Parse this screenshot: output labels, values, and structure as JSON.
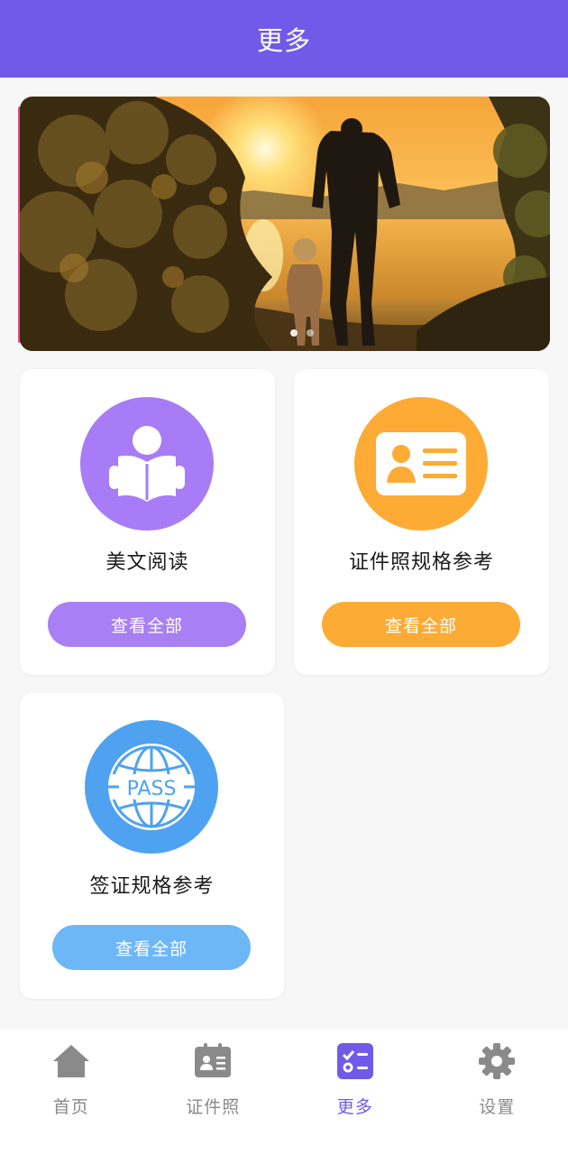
{
  "header": {
    "title": "更多"
  },
  "banner": {
    "active_index": 0,
    "dot_count": 2
  },
  "cards": [
    {
      "title": "美文阅读",
      "button": "查看全部",
      "icon": "reading-book-icon",
      "color": "#a77cf6",
      "button_color": "#a97ff5"
    },
    {
      "title": "证件照规格参考",
      "button": "查看全部",
      "icon": "id-card-icon",
      "color": "#fdab35",
      "button_color": "#fdab35"
    },
    {
      "title": "签证规格参考",
      "button": "查看全部",
      "icon": "passport-globe-icon",
      "icon_text": "PASS",
      "color": "#4ea2f0",
      "button_color": "#6db7f7"
    }
  ],
  "tabbar": {
    "items": [
      {
        "label": "首页",
        "icon": "home-icon",
        "active": false
      },
      {
        "label": "证件照",
        "icon": "id-photo-icon",
        "active": false
      },
      {
        "label": "更多",
        "icon": "more-list-icon",
        "active": true
      },
      {
        "label": "设置",
        "icon": "gear-icon",
        "active": false
      }
    ],
    "active_color": "#725ae8",
    "inactive_color": "#8a8a8a"
  }
}
